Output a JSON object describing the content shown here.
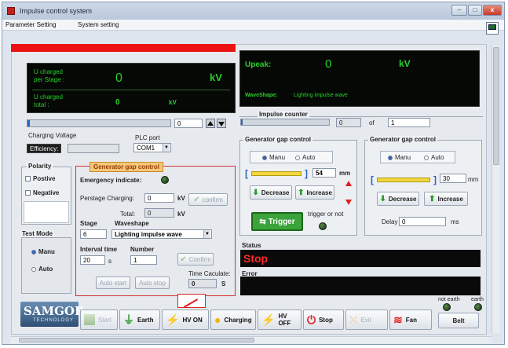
{
  "window": {
    "title": "Impulse control system",
    "min": "–",
    "max": "□",
    "close": "x"
  },
  "menu": {
    "items": [
      "Parameter Setting",
      "System setting"
    ]
  },
  "display_left": {
    "u_stage_label_1": "U charged",
    "u_stage_label_2": "per Stage :",
    "u_stage_value": "0",
    "u_stage_unit": "kV",
    "u_total_label_1": "U charged",
    "u_total_label_2": "total :",
    "u_total_value": "0",
    "u_total_unit": "kV"
  },
  "charging": {
    "value": "0",
    "label": "Charging Voltage",
    "efficiency_label": "Efficiency:",
    "efficiency_value": ""
  },
  "plc": {
    "label": "PLC port",
    "selected": "COM1"
  },
  "polarity": {
    "title": "Polarity",
    "positive": "Postive",
    "negative": "Negative"
  },
  "test_mode": {
    "title": "Test Mode",
    "manu": "Manu",
    "auto": "Auto",
    "selected": "Manu"
  },
  "gen_left": {
    "title": "Generator gap control",
    "emergency": "Emergency indicate:",
    "perstage_label": "Perstage Charging:",
    "perstage_value": "0",
    "perstage_unit": "kV",
    "confirm": "confirm",
    "total_label": "Total:",
    "total_value": "0",
    "total_unit": "kV",
    "stage_label": "Stage",
    "stage_value": "6",
    "waveshape_label": "Waveshape",
    "waveshape_value": "Lighting impulse wave",
    "interval_label": "Interval time",
    "interval_value": "20",
    "interval_unit": "s",
    "number_label": "Number",
    "number_value": "1",
    "confirm2": "Confirm",
    "auto_start": "Auto start",
    "auto_stop": "Auto stop",
    "time_label": "Time Caculate:",
    "time_value": "0",
    "time_unit": "S"
  },
  "display_right": {
    "upeak_label": "Upeak:",
    "upeak_value": "0",
    "upeak_unit": "kV",
    "waveshape_label": "WaveShape:",
    "waveshape_value": "Lighting impulse wave"
  },
  "impulse_counter": {
    "title": "Impulse counter",
    "value": "0",
    "of_label": "of",
    "of_value": "1"
  },
  "gap_mid": {
    "title": "Generator gap control",
    "manu": "Manu",
    "auto": "Auto",
    "value": "54",
    "unit": "mm",
    "decrease": "Decrease",
    "increase": "Increase",
    "trigger": "Trigger",
    "trigger_label": "trigger or not"
  },
  "gap_right": {
    "title": "Generator gap control",
    "manu": "Manu",
    "auto": "Auto",
    "value": "30",
    "unit": "mm",
    "decrease": "Decrease",
    "increase": "Increase",
    "delay_label": "Delay",
    "delay_value": "0",
    "delay_unit": "ms"
  },
  "status": {
    "label": "Status",
    "value": "Stop",
    "error_label": "Error",
    "error_value": ""
  },
  "earth_indicators": {
    "not_earth": "not earth",
    "earth": "earth"
  },
  "toolbar": {
    "logo_main": "SAMGOR",
    "logo_sub": "TECHNOLOGY",
    "start": "Start",
    "earth": "Earth",
    "hv_on": "HV ON",
    "charging": "Charging",
    "hv_off": "HV OFF",
    "stop": "Stop",
    "exit": "Exit",
    "fan": "Fan",
    "belt": "Belt"
  },
  "colors": {
    "lcd_text": "#27d12a",
    "status_text": "#ff2a2a",
    "frame_red": "#d33232",
    "accent_blue": "#2a65c8"
  }
}
